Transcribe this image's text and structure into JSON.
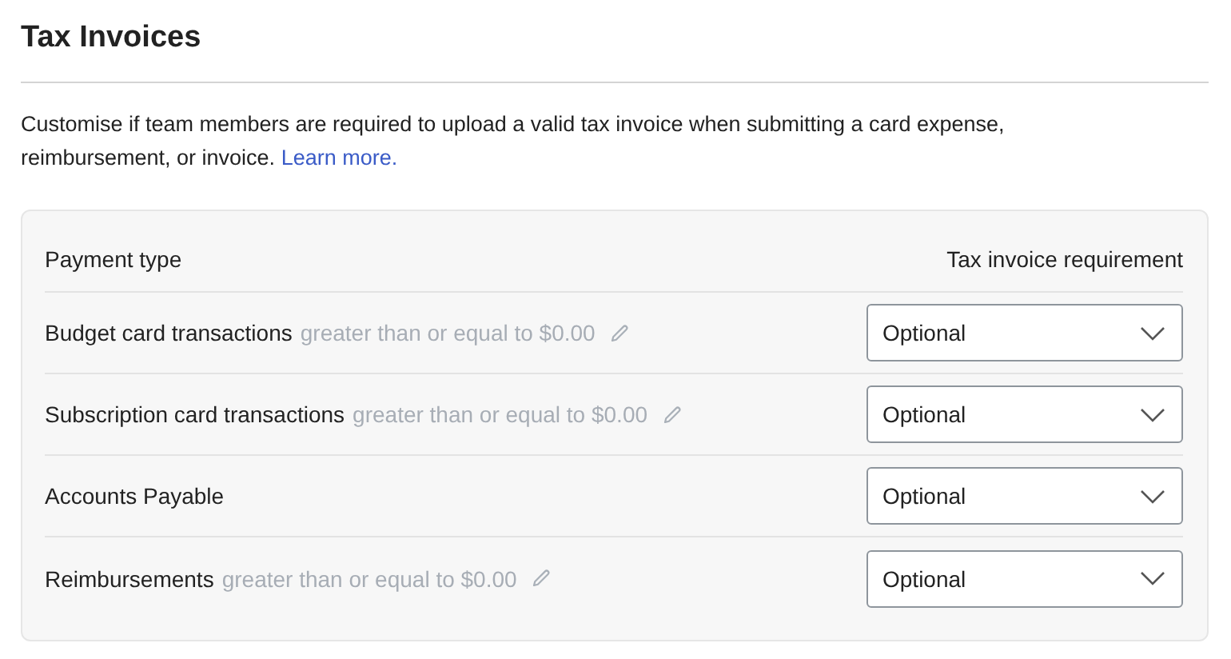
{
  "title": "Tax Invoices",
  "description": {
    "text": "Customise if team members are required to upload a valid tax invoice when submitting a card expense, reimbursement, or invoice.",
    "link": "Learn more."
  },
  "table": {
    "columns": [
      "Payment type",
      "Tax invoice requirement"
    ],
    "rows": [
      {
        "name": "Budget card transactions",
        "condition": "greater than or equal to $0.00",
        "editable": true,
        "requirement": "Optional"
      },
      {
        "name": "Subscription card transactions",
        "condition": "greater than or equal to $0.00",
        "editable": true,
        "requirement": "Optional"
      },
      {
        "name": "Accounts Payable",
        "editable": false,
        "requirement": "Optional"
      },
      {
        "name": "Reimbursements",
        "condition": "greater than or equal to $0.00",
        "editable": true,
        "requirement": "Optional"
      }
    ]
  }
}
